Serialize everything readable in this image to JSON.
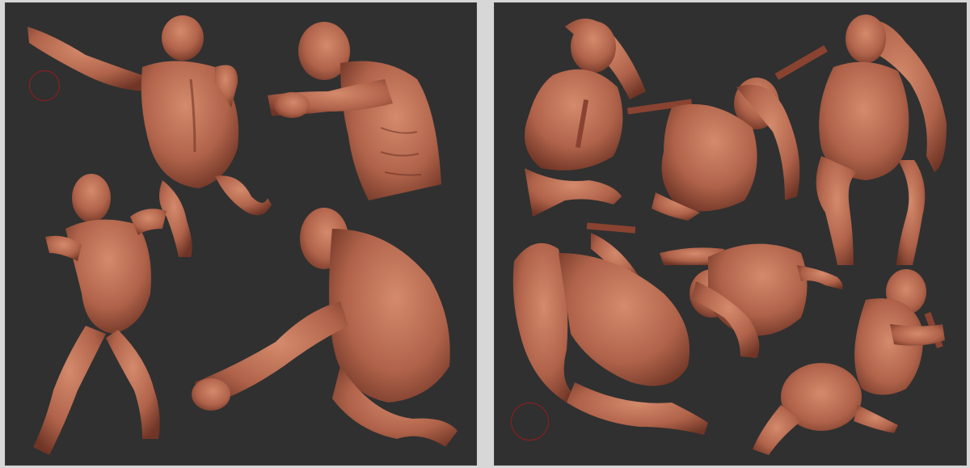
{
  "colors": {
    "background_frame": "#d7d7d7",
    "viewport_background": "#303030",
    "clay_base": "#b0634a",
    "clay_highlight": "#d48a6c",
    "clay_shadow": "#6f3526",
    "brush_cursor": "#9b1b1b"
  },
  "panels": [
    {
      "name": "male-poses",
      "figures": [
        "male-figure-back-reaching",
        "male-torso-punch",
        "male-figure-fighting-stance",
        "male-figure-crouch-punch"
      ],
      "brush_cursor_icon": "circle-icon"
    },
    {
      "name": "female-poses",
      "figures": [
        "female-figure-crouched",
        "female-figure-kneeling-staff",
        "female-figure-squatting-hair",
        "female-figure-crawling-back",
        "female-figure-lunging-staff",
        "female-figure-kneeling-back"
      ],
      "brush_cursor_icon": "circle-icon"
    }
  ]
}
